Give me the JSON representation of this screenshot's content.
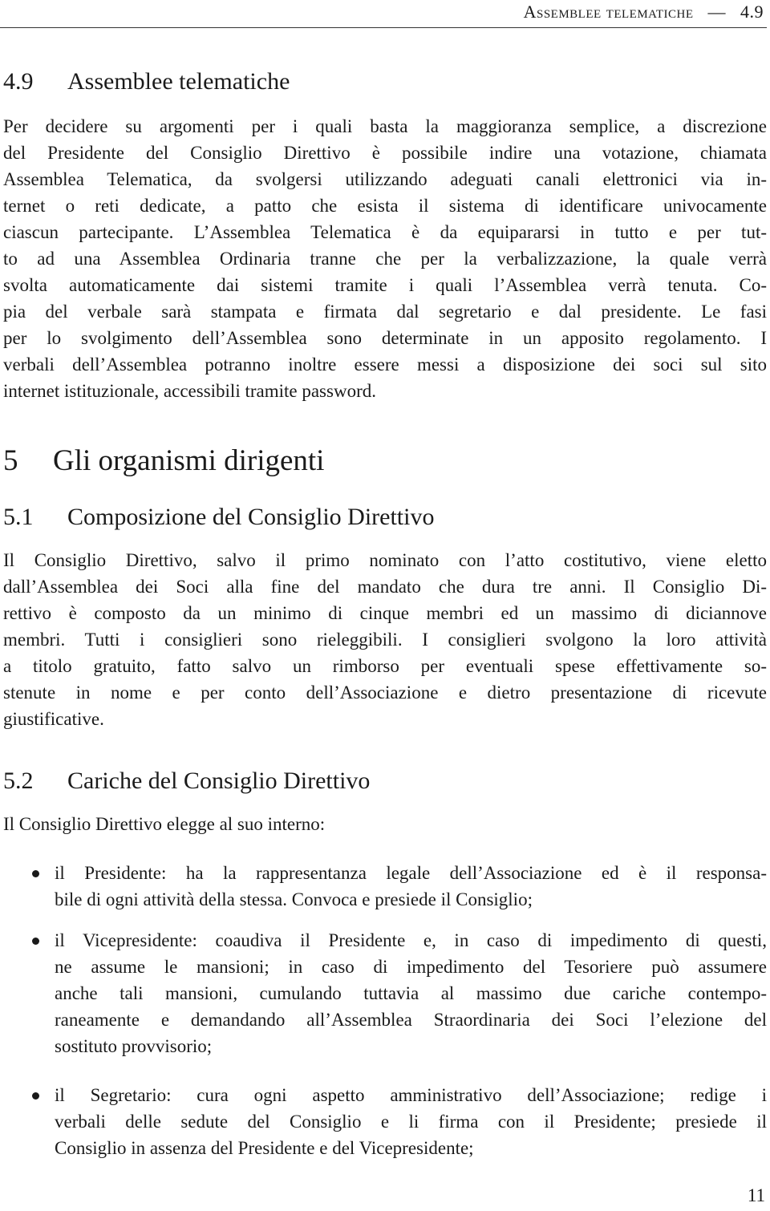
{
  "running_head": {
    "title": "Assemblee telematiche",
    "separator": "—",
    "section": "4.9"
  },
  "section_4_9": {
    "number": "4.9",
    "title": "Assemblee telematiche",
    "paragraph_lines": [
      "Per decidere su argomenti per i quali basta la maggioranza semplice, a discrezione",
      "del Presidente del Consiglio Direttivo è possibile indire una votazione, chiamata",
      "Assemblea Telematica, da svolgersi utilizzando adeguati canali elettronici via in-",
      "ternet o reti dedicate, a patto che esista il sistema di identificare univocamente",
      "ciascun partecipante. L’Assemblea Telematica è da equipararsi in tutto e per tut-",
      "to ad una Assemblea Ordinaria tranne che per la verbalizzazione, la quale verrà",
      "svolta automaticamente dai sistemi tramite i quali l’Assemblea verrà tenuta. Co-",
      "pia del verbale sarà stampata e firmata dal segretario e dal presidente. Le fasi",
      "per lo svolgimento dell’Assemblea sono determinate in un apposito regolamento. I",
      "verbali dell’Assemblea potranno inoltre essere messi a disposizione dei soci sul sito",
      "internet istituzionale, accessibili tramite password."
    ]
  },
  "section_5": {
    "number": "5",
    "title": "Gli organismi dirigenti"
  },
  "section_5_1": {
    "number": "5.1",
    "title": "Composizione del Consiglio Direttivo",
    "paragraph_lines": [
      "Il Consiglio Direttivo, salvo il primo nominato con l’atto costitutivo, viene eletto",
      "dall’Assemblea dei Soci alla fine del mandato che dura tre anni. Il Consiglio Di-",
      "rettivo è composto da un minimo di cinque membri ed un massimo di diciannove",
      "membri. Tutti i consiglieri sono rieleggibili. I consiglieri svolgono la loro attività",
      "a titolo gratuito, fatto salvo un rimborso per eventuali spese effettivamente so-",
      "stenute in nome e per conto dell’Associazione e dietro presentazione di ricevute",
      "giustificative."
    ]
  },
  "section_5_2": {
    "number": "5.2",
    "title": "Cariche del Consiglio Direttivo",
    "intro": "Il Consiglio Direttivo elegge al suo interno:",
    "items": [
      {
        "lines": [
          "il Presidente: ha la rappresentanza legale dell’Associazione ed è il responsa-",
          "bile di ogni attività della stessa. Convoca e presiede il Consiglio;"
        ]
      },
      {
        "lines": [
          "il Vicepresidente: coaudiva il Presidente e, in caso di impedimento di questi,",
          "ne assume le mansioni; in caso di impedimento del Tesoriere può assumere",
          "anche tali mansioni, cumulando tuttavia al massimo due cariche contempo-",
          "raneamente e demandando all’Assemblea Straordinaria dei Soci l’elezione del",
          "sostituto provvisorio;"
        ]
      },
      {
        "lines": [
          "il Segretario: cura ogni aspetto amministrativo dell’Associazione; redige i",
          "verbali delle sedute del Consiglio e li firma con il Presidente; presiede il",
          "Consiglio in assenza del Presidente e del Vicepresidente;"
        ]
      }
    ]
  },
  "page_number": "11"
}
